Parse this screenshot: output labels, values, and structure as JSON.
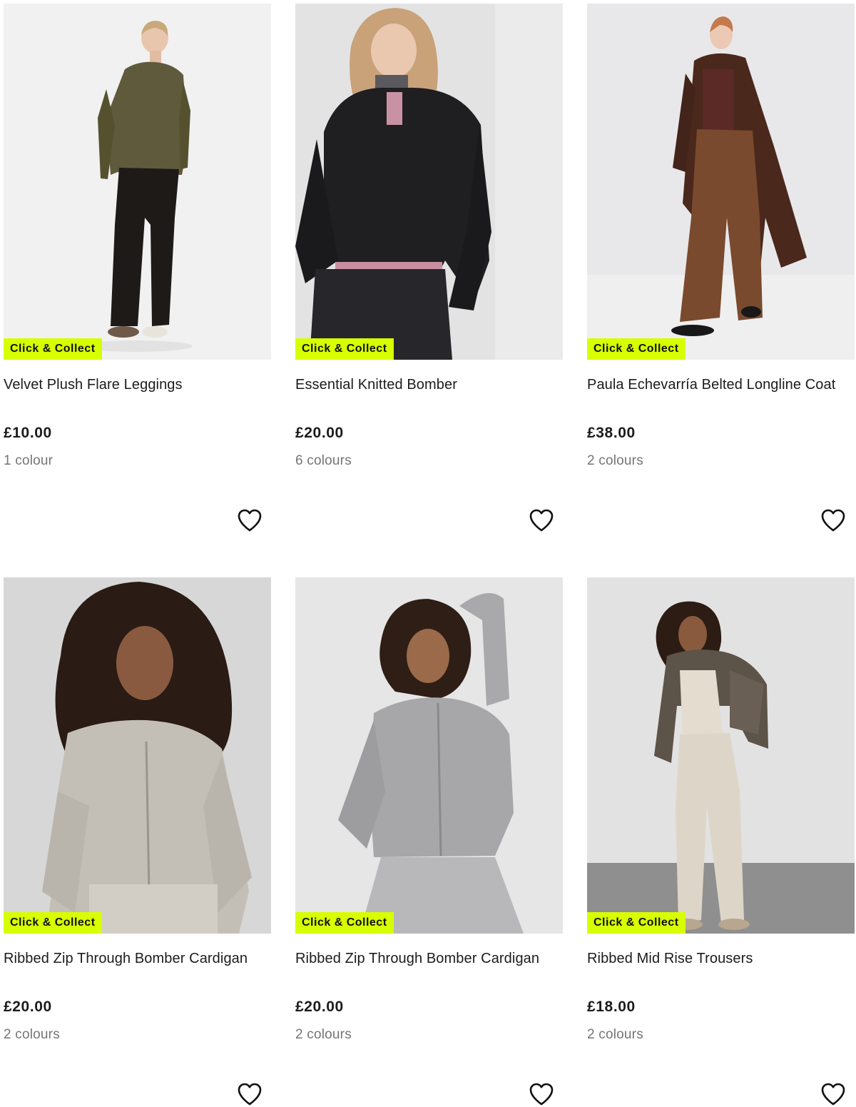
{
  "badge_color": "#d7ff00",
  "products": [
    {
      "name": "Velvet Plush Flare Leggings",
      "price": "£10.00",
      "colours": "1 colour",
      "badge": "Click & Collect",
      "image": "model-olive-top-black-flare-leggings"
    },
    {
      "name": "Essential Knitted Bomber",
      "price": "£20.00",
      "colours": "6 colours",
      "badge": "Click & Collect",
      "image": "model-black-knitted-bomber"
    },
    {
      "name": "Paula Echevarría Belted Longline Coat",
      "price": "£38.00",
      "colours": "2 colours",
      "badge": "Click & Collect",
      "image": "model-brown-longline-coat"
    },
    {
      "name": "Ribbed Zip Through Bomber Cardigan",
      "price": "£20.00",
      "colours": "2 colours",
      "badge": "Click & Collect",
      "image": "model-oatmeal-zip-cardigan"
    },
    {
      "name": "Ribbed Zip Through Bomber Cardigan",
      "price": "£20.00",
      "colours": "2 colours",
      "badge": "Click & Collect",
      "image": "model-grey-zip-cardigan"
    },
    {
      "name": "Ribbed Mid Rise Trousers",
      "price": "£18.00",
      "colours": "2 colours",
      "badge": "Click & Collect",
      "image": "model-cream-ribbed-trousers"
    }
  ]
}
